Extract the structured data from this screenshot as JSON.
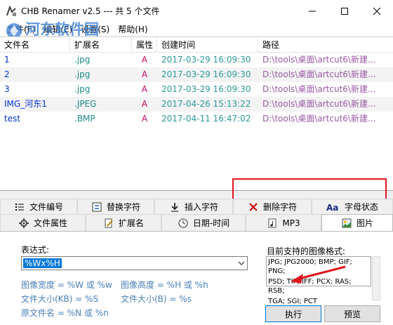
{
  "window": {
    "title": "CHB Renamer v2.5 --- 共 5 个文件"
  },
  "watermark": {
    "site_name": "河东软件园",
    "url": "www.pc0359.cn"
  },
  "menu": {
    "items": [
      "文件(F)",
      "编辑(E)",
      "设置(S)",
      "帮助(H)"
    ]
  },
  "table": {
    "columns": [
      "文件名",
      "扩展名",
      "属性",
      "创建时间",
      "路径"
    ],
    "rows": [
      {
        "name": "1",
        "ext": ".jpg",
        "attr": "A",
        "time": "2017-03-29 16:09:30",
        "path": "D:\\tools\\桌面\\artcut6\\新建..."
      },
      {
        "name": "2",
        "ext": ".jpg",
        "attr": "A",
        "time": "2017-03-29 16:09:30",
        "path": "D:\\tools\\桌面\\artcut6\\新建..."
      },
      {
        "name": "3",
        "ext": ".jpg",
        "attr": "A",
        "time": "2017-03-29 16:09:30",
        "path": "D:\\tools\\桌面\\artcut6\\新建..."
      },
      {
        "name": "IMG_河东1",
        "ext": ".JPEG",
        "attr": "A",
        "time": "2017-04-26 15:13:22",
        "path": "D:\\tools\\桌面\\artcut6\\新建..."
      },
      {
        "name": "test",
        "ext": ".BMP",
        "attr": "A",
        "time": "2017-04-11 16:47:02",
        "path": "D:\\tools\\桌面\\artcut6\\新建..."
      }
    ]
  },
  "tabs_row1": [
    "文件编号",
    "替换字符",
    "插入字符",
    "删除字符",
    "字母状态"
  ],
  "tabs_row2": [
    "文件属性",
    "扩展名",
    "日期-时间",
    "MP3",
    "图片"
  ],
  "active_tab": "图片",
  "panel": {
    "expr_label": "表达式:",
    "expr_value": "%Wx%H",
    "hints": {
      "width": "图像宽度 = %W 或 %w",
      "height": "图像高度 = %H 或 %h",
      "size_kb": "文件大小(KB) = %S",
      "size_b": "文件大小(B) = %s",
      "orig_name": "原文件名 = %N 或 %n"
    },
    "formats_label": "目前支持的图像格式:",
    "formats": [
      "JPG; JPG2000; BMP; GIF; PNG;",
      "PSD; TIF; IFF; PCX; RAS; RSB;",
      "TGA; SGI; PCT"
    ],
    "execute_label": "执行",
    "preview_label": "预览"
  },
  "colors": {
    "highlight": "#e0141e",
    "selection": "#0078d7"
  }
}
